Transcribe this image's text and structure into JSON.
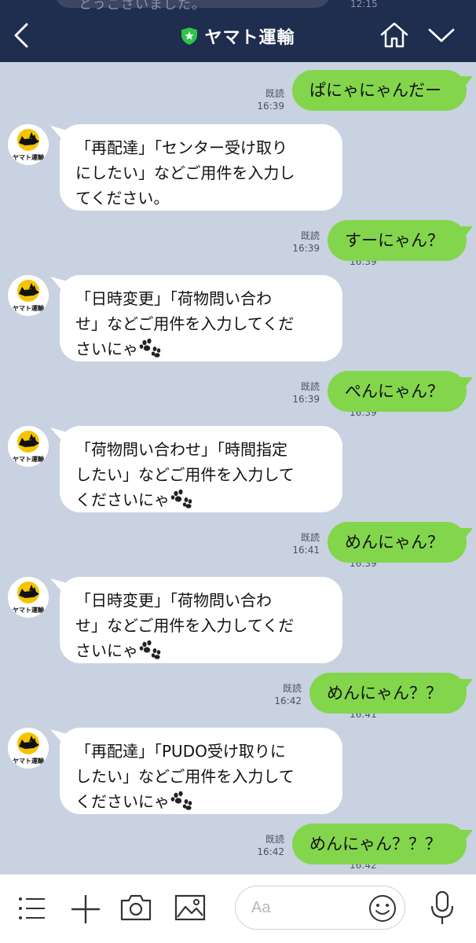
{
  "header": {
    "title": "ヤマト運輸",
    "peek_text": "とうございました。",
    "peek_time": "12:15"
  },
  "messages": [
    {
      "type": "out",
      "text": "ぱにゃにゃんだー",
      "read": "既読",
      "time": "16:39"
    },
    {
      "type": "in",
      "text": "「再配達」「センター受け取り\nにしたい」などご用件を入力し\nてください。",
      "paw": false,
      "time": "16:39"
    },
    {
      "type": "out",
      "text": "すーにゃん？",
      "read": "既読",
      "time": "16:39"
    },
    {
      "type": "in",
      "text": "「日時変更」「荷物問い合わ\nせ」などご用件を入力してくだ\nさいにゃ",
      "paw": true,
      "time": "16:39"
    },
    {
      "type": "out",
      "text": "ぺんにゃん？",
      "read": "既読",
      "time": "16:39"
    },
    {
      "type": "in",
      "text": "「荷物問い合わせ」「時間指定\nしたい」などご用件を入力して\nくださいにゃ",
      "paw": true,
      "time": "16:39"
    },
    {
      "type": "out",
      "text": "めんにゃん？",
      "read": "既読",
      "time": "16:41"
    },
    {
      "type": "in",
      "text": "「日時変更」「荷物問い合わ\nせ」などご用件を入力してくだ\nさいにゃ",
      "paw": true,
      "time": "16:41"
    },
    {
      "type": "out",
      "text": "めんにゃん？？",
      "read": "既読",
      "time": "16:42"
    },
    {
      "type": "in",
      "text": "「再配達」「PUDO受け取りに\nしたい」などご用件を入力して\nくださいにゃ",
      "paw": true,
      "time": "16:42"
    },
    {
      "type": "out",
      "text": "めんにゃん？？？",
      "read": "既読",
      "time": "16:42"
    }
  ],
  "avatar_label": "ヤマト運輸",
  "input": {
    "placeholder": "Aa"
  },
  "colors": {
    "header": "#1f2d4e",
    "chat_bg": "#c9d2e1",
    "out_bubble": "#83d64c",
    "in_bubble": "#ffffff",
    "shield": "#2ec44a"
  },
  "icons": [
    "back-chevron-icon",
    "shield-icon",
    "home-icon",
    "chevron-down-icon",
    "menu-icon",
    "plus-icon",
    "camera-icon",
    "image-icon",
    "smile-icon",
    "mic-icon"
  ]
}
